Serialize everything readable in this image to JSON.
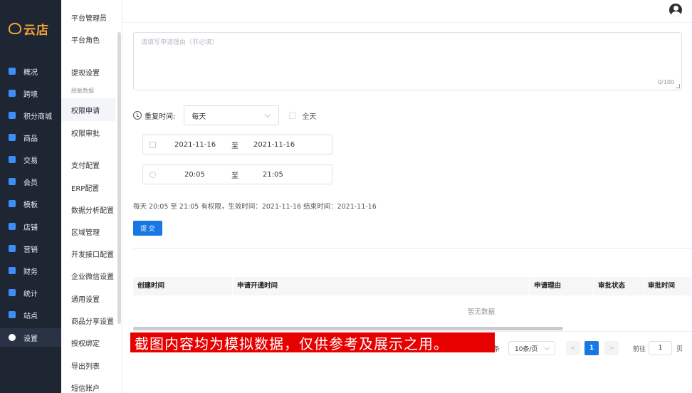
{
  "brand": {
    "name": "云店",
    "color": "#f4a637"
  },
  "colors": {
    "sidebar_bg": "#1f2633",
    "primary": "#1677e5",
    "disclaimer_bg": "#e60000"
  },
  "sidebar": {
    "items": [
      {
        "label": "概况",
        "icon": "dashboard-icon",
        "icon_color": "#3e8ef7"
      },
      {
        "label": "跨境",
        "icon": "globe-icon",
        "icon_color": "#3e8ef7"
      },
      {
        "label": "积分商城",
        "icon": "points-mall-icon",
        "icon_color": "#3e8ef7"
      },
      {
        "label": "商品",
        "icon": "bag-icon",
        "icon_color": "#3e8ef7"
      },
      {
        "label": "交易",
        "icon": "receipt-icon",
        "icon_color": "#3e8ef7"
      },
      {
        "label": "会员",
        "icon": "diamond-icon",
        "icon_color": "#3e8ef7"
      },
      {
        "label": "模板",
        "icon": "template-icon",
        "icon_color": "#3e8ef7"
      },
      {
        "label": "店铺",
        "icon": "store-icon",
        "icon_color": "#3e8ef7"
      },
      {
        "label": "营销",
        "icon": "gift-icon",
        "icon_color": "#3e8ef7"
      },
      {
        "label": "财务",
        "icon": "wallet-icon",
        "icon_color": "#3e8ef7"
      },
      {
        "label": "统计",
        "icon": "chart-icon",
        "icon_color": "#3e8ef7"
      },
      {
        "label": "站点",
        "icon": "sitemap-icon",
        "icon_color": "#3e8ef7"
      },
      {
        "label": "设置",
        "icon": "gear-icon",
        "icon_color": "#ffffff",
        "active": true
      }
    ]
  },
  "submenu": {
    "items": [
      {
        "label": "平台管理员"
      },
      {
        "label": "平台角色"
      },
      {
        "label": "提现设置"
      },
      {
        "label": "脱敏数据",
        "small": true
      },
      {
        "label": "权限申请",
        "active": true
      },
      {
        "label": "权限审批"
      },
      {
        "label": "支付配置"
      },
      {
        "label": "ERP配置"
      },
      {
        "label": "数据分析配置"
      },
      {
        "label": "区域管理"
      },
      {
        "label": "开发接口配置"
      },
      {
        "label": "企业微信设置"
      },
      {
        "label": "通用设置"
      },
      {
        "label": "商品分享设置"
      },
      {
        "label": "授权绑定"
      },
      {
        "label": "导出列表"
      },
      {
        "label": "短信账户"
      }
    ]
  },
  "form": {
    "reason_placeholder": "请填写申请理由（非必填）",
    "reason_counter": "0/100",
    "repeat_label": "重复时间:",
    "repeat_value": "每天",
    "all_day_label": "全天",
    "date_start": "2021-11-16",
    "date_sep": "至",
    "date_end": "2021-11-16",
    "time_start": "20:05",
    "time_sep": "至",
    "time_end": "21:05",
    "summary": "每天 20:05 至 21:05 有权限，生效时间：2021-11-16 结束时间：2021-11-16",
    "submit_label": "提 交"
  },
  "table": {
    "columns": [
      "创建时间",
      "申请开通时间",
      "申请理由",
      "审批状态",
      "审批时间"
    ],
    "rows": [],
    "empty_text": "暂无数据"
  },
  "pagination": {
    "tiao_suffix": "条",
    "page_size": "10条/页",
    "prev": "<",
    "current_page": "1",
    "next": ">",
    "goto_label": "前往",
    "goto_value": "1",
    "page_suffix": "页"
  },
  "disclaimer": "截图内容均为模拟数据，仅供参考及展示之用。"
}
